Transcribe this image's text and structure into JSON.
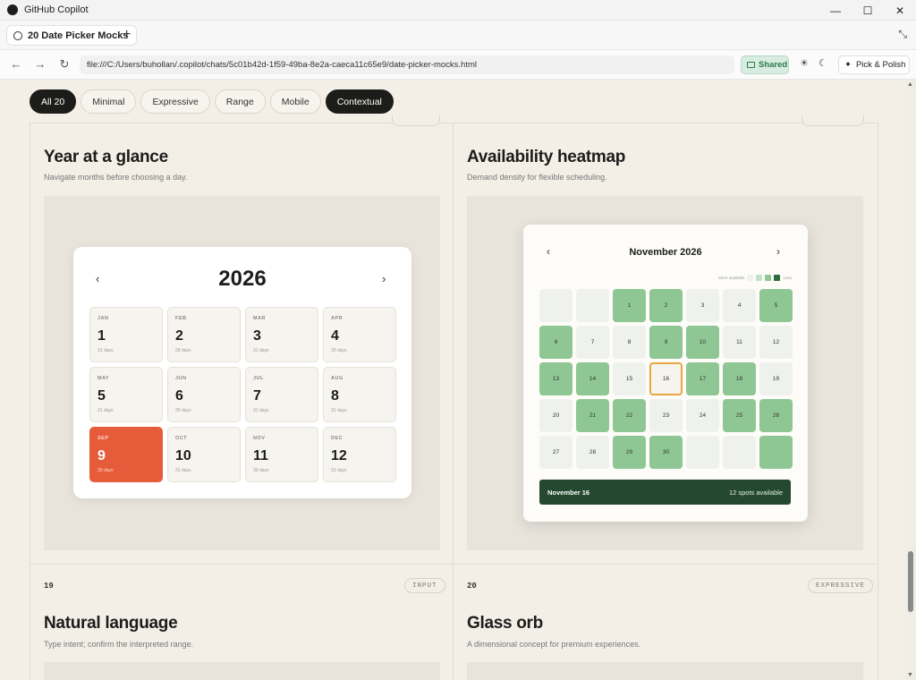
{
  "window": {
    "title": "GitHub Copilot"
  },
  "tab": {
    "label": "20 Date Picker Mocks"
  },
  "address": {
    "url": "file:///C:/Users/buhollan/.copilot/chats/5c01b42d-1f59-49ba-8e2a-caeca11c65e9/date-picker-mocks.html"
  },
  "toolbar": {
    "shared_label": "Shared",
    "pick_label": "Pick & Polish"
  },
  "filters": [
    {
      "label": "All 20",
      "active": true
    },
    {
      "label": "Minimal",
      "active": false
    },
    {
      "label": "Expressive",
      "active": false
    },
    {
      "label": "Range",
      "active": false
    },
    {
      "label": "Mobile",
      "active": false
    },
    {
      "label": "Contextual",
      "active": true
    }
  ],
  "cards": {
    "year": {
      "title": "Year at a glance",
      "subtitle": "Navigate months before choosing a day.",
      "year": "2026",
      "months": [
        {
          "name": "JAN",
          "day": "1",
          "len": "31 days",
          "selected": false
        },
        {
          "name": "FEB",
          "day": "2",
          "len": "28 days",
          "selected": false
        },
        {
          "name": "MAR",
          "day": "3",
          "len": "31 days",
          "selected": false
        },
        {
          "name": "APR",
          "day": "4",
          "len": "30 days",
          "selected": false
        },
        {
          "name": "MAY",
          "day": "5",
          "len": "31 days",
          "selected": false
        },
        {
          "name": "JUN",
          "day": "6",
          "len": "30 days",
          "selected": false
        },
        {
          "name": "JUL",
          "day": "7",
          "len": "31 days",
          "selected": false
        },
        {
          "name": "AUG",
          "day": "8",
          "len": "31 days",
          "selected": false
        },
        {
          "name": "SEP",
          "day": "9",
          "len": "30 days",
          "selected": true
        },
        {
          "name": "OCT",
          "day": "10",
          "len": "31 days",
          "selected": false
        },
        {
          "name": "NOV",
          "day": "11",
          "len": "30 days",
          "selected": false
        },
        {
          "name": "DEC",
          "day": "12",
          "len": "31 days",
          "selected": false
        }
      ]
    },
    "heatmap": {
      "title": "Availability heatmap",
      "subtitle": "Demand density for flexible scheduling.",
      "month": "November 2026",
      "legend_more": "More available",
      "legend_less": "Less",
      "legend_colors": [
        "#eef1ec",
        "#c4e0c5",
        "#8fc794",
        "#2f6b3c"
      ],
      "days": [
        {
          "label": "",
          "level": 0
        },
        {
          "label": "",
          "level": 0
        },
        {
          "label": "1",
          "level": 2
        },
        {
          "label": "2",
          "level": 2
        },
        {
          "label": "3",
          "level": 0
        },
        {
          "label": "4",
          "level": 0
        },
        {
          "label": "5",
          "level": 2
        },
        {
          "label": "6",
          "level": 2
        },
        {
          "label": "7",
          "level": 0
        },
        {
          "label": "8",
          "level": 0
        },
        {
          "label": "9",
          "level": 2
        },
        {
          "label": "10",
          "level": 2
        },
        {
          "label": "11",
          "level": 0
        },
        {
          "label": "12",
          "level": 0
        },
        {
          "label": "13",
          "level": 2
        },
        {
          "label": "14",
          "level": 2
        },
        {
          "label": "15",
          "level": 0
        },
        {
          "label": "16",
          "level": 0,
          "selected": true
        },
        {
          "label": "17",
          "level": 2
        },
        {
          "label": "18",
          "level": 2
        },
        {
          "label": "19",
          "level": 0
        },
        {
          "label": "20",
          "level": 0
        },
        {
          "label": "21",
          "level": 2
        },
        {
          "label": "22",
          "level": 2
        },
        {
          "label": "23",
          "level": 0
        },
        {
          "label": "24",
          "level": 0
        },
        {
          "label": "25",
          "level": 2
        },
        {
          "label": "26",
          "level": 2
        },
        {
          "label": "27",
          "level": 0
        },
        {
          "label": "28",
          "level": 0
        },
        {
          "label": "29",
          "level": 2
        },
        {
          "label": "30",
          "level": 2
        },
        {
          "label": "",
          "level": 0
        },
        {
          "label": "",
          "level": 0
        },
        {
          "label": "",
          "level": 2
        }
      ],
      "footer_date": "November 16",
      "footer_spots": "12 spots available"
    },
    "natural": {
      "number": "19",
      "badge": "INPUT",
      "title": "Natural language",
      "subtitle": "Type intent; confirm the interpreted range."
    },
    "glass": {
      "number": "20",
      "badge": "EXPRESSIVE",
      "title": "Glass orb",
      "subtitle": "A dimensional concept for premium experiences."
    }
  }
}
